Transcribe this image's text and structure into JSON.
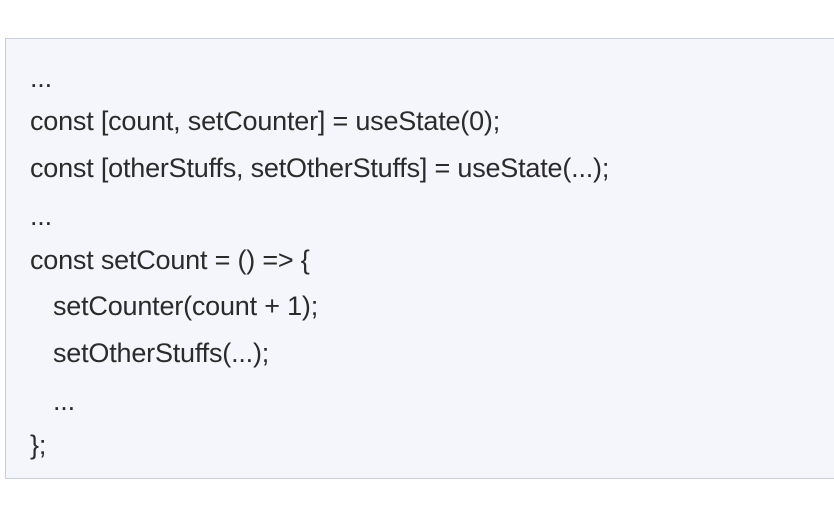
{
  "code": {
    "lines": [
      "...",
      "const [count, setCounter] = useState(0);",
      "const [otherStuffs, setOtherStuffs] = useState(...);",
      "...",
      "const setCount = () => {",
      "setCounter(count + 1);",
      "setOtherStuffs(...);",
      "...",
      "};"
    ]
  }
}
